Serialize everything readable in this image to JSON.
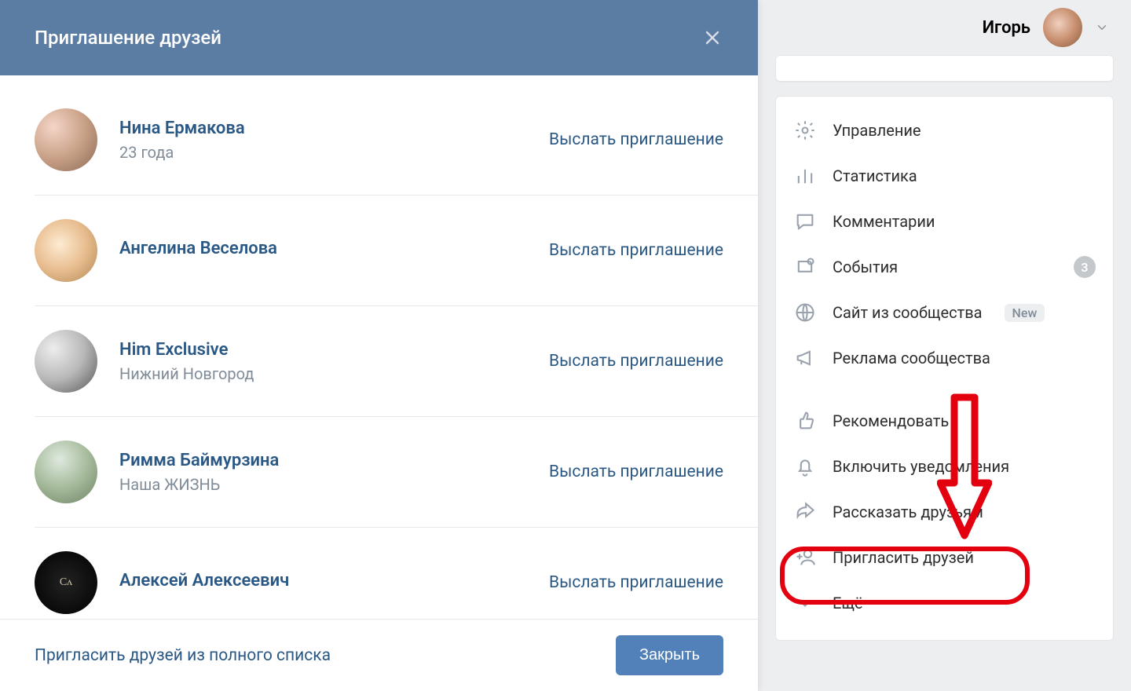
{
  "modal": {
    "title": "Приглашение друзей",
    "invite_action": "Выслать приглашение",
    "footer_link": "Пригласить друзей из полного списка",
    "close_button": "Закрыть",
    "friends": [
      {
        "name": "Нина Ермакова",
        "sub": "23 года"
      },
      {
        "name": "Ангелина Веселова",
        "sub": ""
      },
      {
        "name": "Him Exclusive",
        "sub": "Нижний Новгород"
      },
      {
        "name": "Римма Баймурзина",
        "sub": "Наша ЖИЗНЬ"
      },
      {
        "name": "Алексей Алексеевич",
        "sub": ""
      }
    ]
  },
  "topbar": {
    "user_name": "Игорь"
  },
  "sidebar": {
    "items": [
      {
        "label": "Управление",
        "icon": "gear-icon"
      },
      {
        "label": "Статистика",
        "icon": "bars-icon"
      },
      {
        "label": "Комментарии",
        "icon": "speech-bubble-icon"
      },
      {
        "label": "События",
        "icon": "bell-badge-icon",
        "count": "3"
      },
      {
        "label": "Сайт из сообщества",
        "icon": "globe-icon",
        "badge_new": "New"
      },
      {
        "label": "Реклама сообщества",
        "icon": "megaphone-icon"
      },
      {
        "label": "Рекомендовать",
        "icon": "thumbs-up-icon"
      },
      {
        "label": "Включить уведомления",
        "icon": "bell-icon"
      },
      {
        "label": "Рассказать друзьям",
        "icon": "share-icon"
      },
      {
        "label": "Пригласить друзей",
        "icon": "add-user-icon"
      },
      {
        "label": "Ещё",
        "icon": "chevron-down-icon"
      }
    ]
  }
}
